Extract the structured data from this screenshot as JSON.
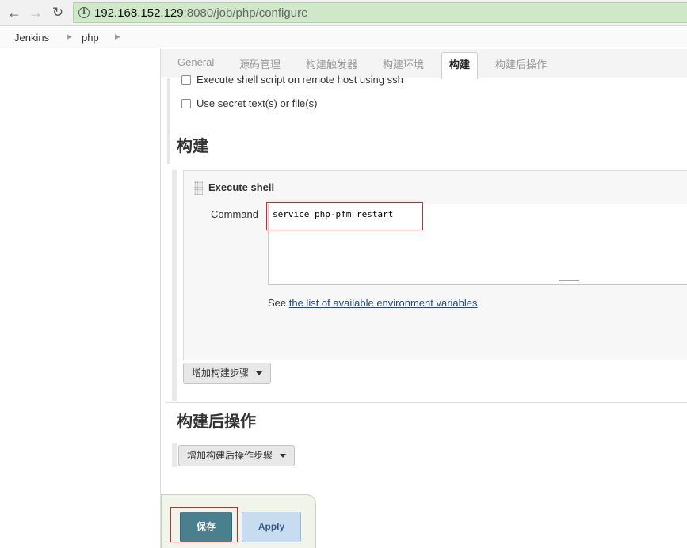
{
  "browser": {
    "url_host": "192.168.152.129",
    "url_rest": ":8080/job/php/configure"
  },
  "breadcrumb": {
    "items": [
      "Jenkins",
      "php"
    ]
  },
  "tabs": {
    "items": [
      "General",
      "源码管理",
      "构建触发器",
      "构建环境",
      "构建",
      "构建后操作"
    ],
    "active": "构建"
  },
  "prev_section": {
    "option_remote_shell": "Execute shell script on remote host using ssh",
    "option_secret": "Use secret text(s) or file(s)"
  },
  "build": {
    "title": "构建",
    "step_title": "Execute shell",
    "command_label": "Command",
    "command_value": "service php-pfm restart",
    "env_hint_prefix": "See ",
    "env_hint_link": "the list of available environment variables",
    "add_step_label": "增加构建步骤"
  },
  "post_build": {
    "title": "构建后操作",
    "add_step_label": "增加构建后操作步骤"
  },
  "actions": {
    "save_label": "保存",
    "apply_label": "Apply"
  },
  "colors": {
    "save_bg": "#4a7f8e",
    "apply_bg": "#c8dcef",
    "url_bar_bg": "#cfe8c8",
    "highlight_border": "#e02020"
  }
}
